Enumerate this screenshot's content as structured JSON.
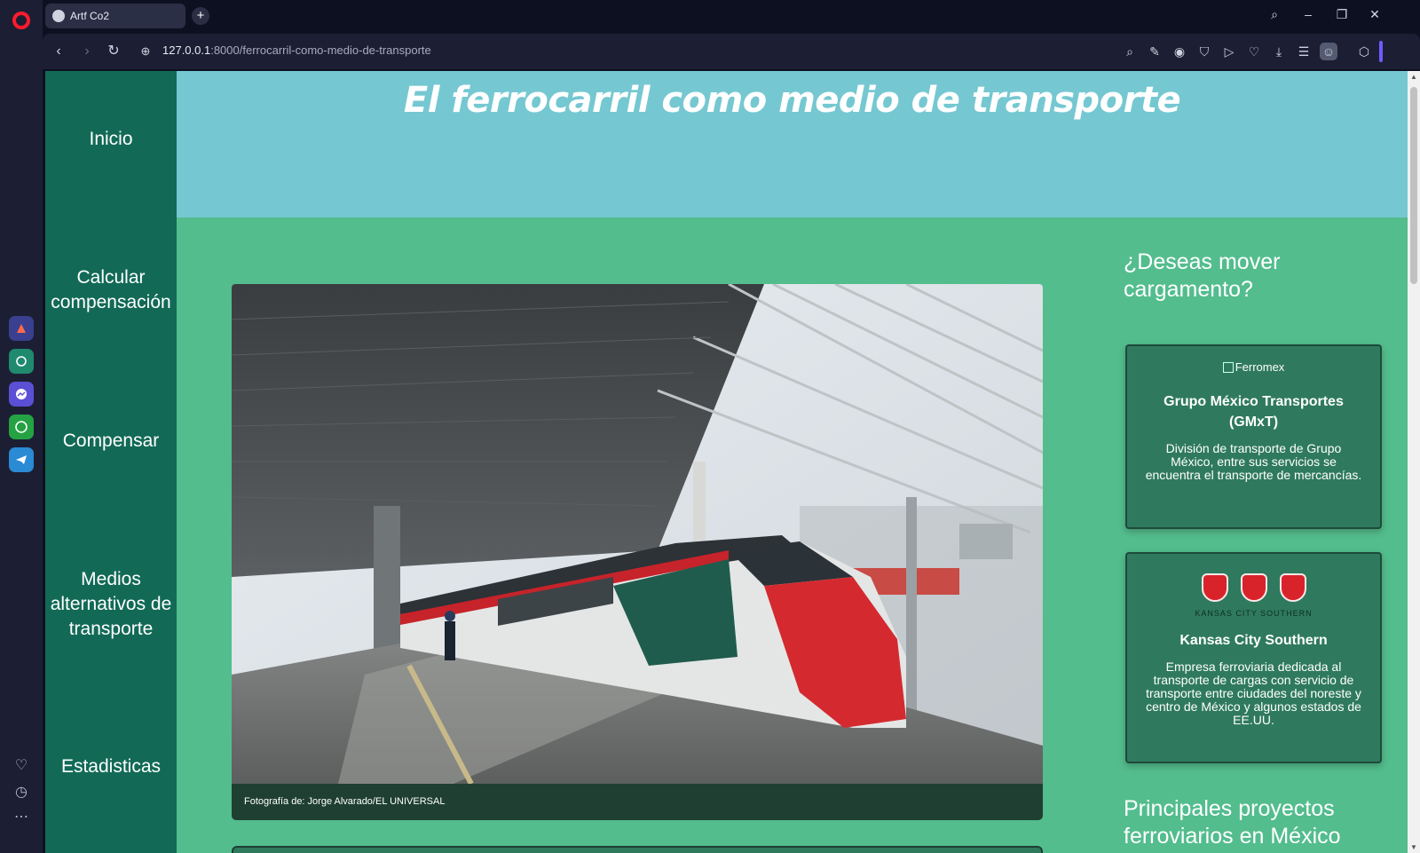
{
  "browser": {
    "tab_title": "Artf Co2",
    "new_tab": "+",
    "url_host": "127.0.0.1",
    "url_path": ":8000/ferrocarril-como-medio-de-transporte"
  },
  "sidebar": {
    "items": [
      {
        "label": "Inicio"
      },
      {
        "label": "Calcular compensación"
      },
      {
        "label": "Compensar"
      },
      {
        "label": "Medios alternativos de transporte"
      },
      {
        "label": "Estadisticas"
      }
    ]
  },
  "banner": {
    "title": "El ferrocarril como medio de transporte"
  },
  "main": {
    "photo_caption": "Fotografía de: Jorge Alvarado/EL UNIVERSAL"
  },
  "aside": {
    "title": "¿Deseas mover cargamento?",
    "cards": [
      {
        "image_alt": "Ferromex",
        "name": "Grupo México Transportes (GMxT)",
        "description": "División de transporte de Grupo México, entre sus servicios se encuentra el transporte de mercancías."
      },
      {
        "logo_text": "KANSAS CITY SOUTHERN",
        "name": "Kansas City Southern",
        "description": "Empresa ferroviaria dedicada al transporte de cargas con servicio de transporte entre ciudades del noreste y centro de México y algunos estados de EE.UU."
      }
    ],
    "title2": "Principales proyectos ferroviarios en México"
  },
  "icons": [
    "opera-logo-icon",
    "globe-icon",
    "back-icon",
    "forward-icon",
    "reload-icon",
    "site-info-icon",
    "search-icon",
    "minimize-icon",
    "maximize-icon",
    "close-icon",
    "heart-icon",
    "history-icon",
    "more-icon"
  ],
  "colors": {
    "sidebar": "#126a56",
    "banner": "#75c8d1",
    "page_bg": "#53bd8d",
    "card_bg": "#2f7a5e"
  }
}
